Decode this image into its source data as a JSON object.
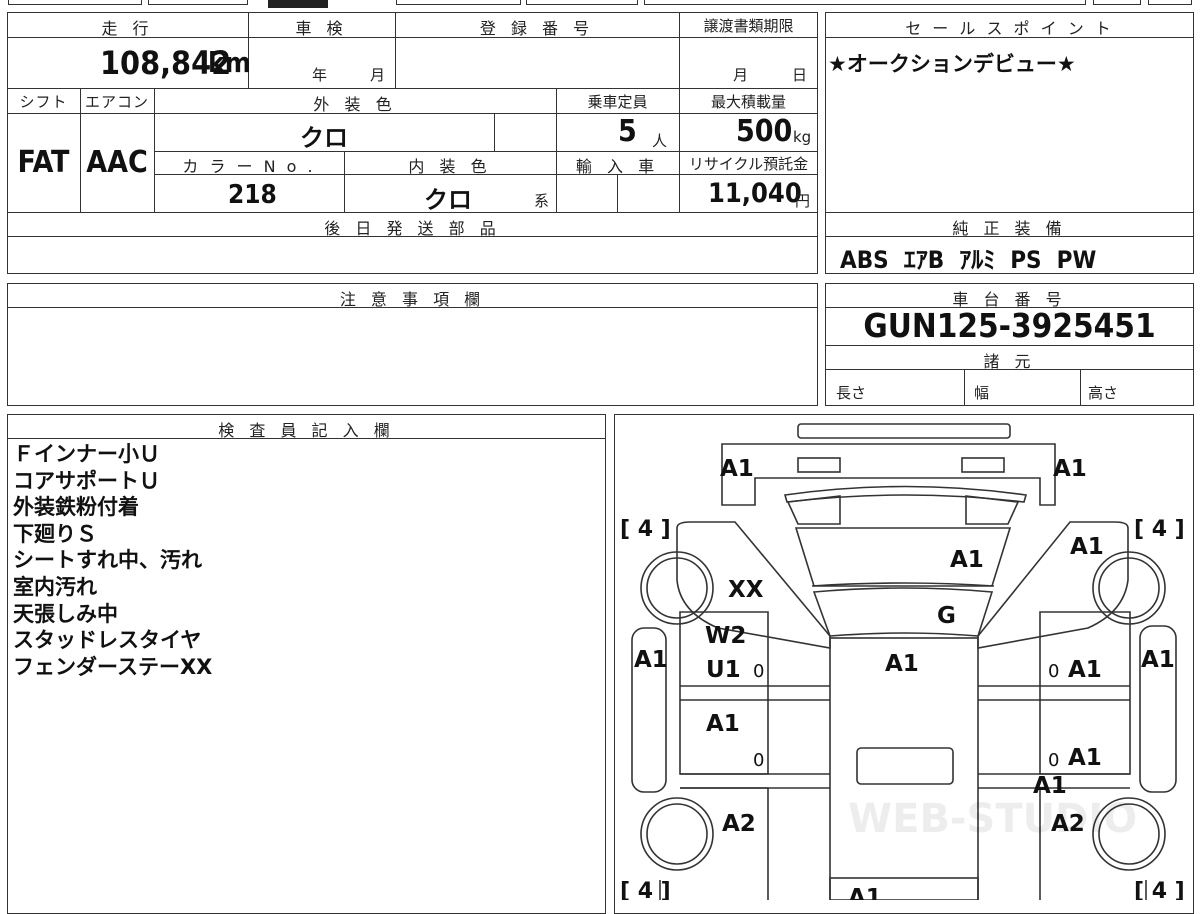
{
  "mileage": {
    "label": "走 行",
    "value": "108,842",
    "unit": "km"
  },
  "shaken": {
    "label": "車 検",
    "year_unit": "年",
    "month_unit": "月"
  },
  "registration": {
    "label": "登 録 番 号"
  },
  "transfer_deadline": {
    "label": "譲渡書類期限",
    "month_unit": "月",
    "day_unit": "日"
  },
  "shift": {
    "label": "シフト",
    "value": "FAT"
  },
  "aircon": {
    "label": "エアコン",
    "value": "AAC"
  },
  "exterior_color": {
    "label": "外 装 色",
    "value": "クロ"
  },
  "capacity": {
    "label": "乗車定員",
    "value": "5",
    "unit": "人"
  },
  "max_load": {
    "label": "最大積載量",
    "value": "500",
    "unit": "kg"
  },
  "color_no": {
    "label": "カ ラ ー N o .",
    "value": "218"
  },
  "interior_color": {
    "label": "内 装 色",
    "value": "クロ",
    "suffix": "系"
  },
  "import": {
    "label": "輸 入 車"
  },
  "recycle": {
    "label": "リサイクル預託金",
    "value": "11,040",
    "unit": "円"
  },
  "parts_later": {
    "label": "後 日 発 送 部 品"
  },
  "sales_point": {
    "label": "セ ー ル ス ポ イ ン ト",
    "text": "★オークションデビュー★"
  },
  "equipment": {
    "label": "純 正 装 備",
    "items": "ABS  ｴｱB  ｱﾙﾐ  PS  PW"
  },
  "notes": {
    "label": "注 意 事 項 欄"
  },
  "chassis": {
    "label": "車 台 番 号",
    "value": "GUN125-3925451"
  },
  "specs": {
    "label": "諸 元",
    "length": "長さ",
    "width": "幅",
    "height": "高さ"
  },
  "inspector": {
    "label": "検 査 員 記 入 欄",
    "lines": [
      "Ｆインナー小Ｕ",
      "コアサポートＵ",
      "外装鉄粉付着",
      "下廻りＳ",
      "シートすれ中、汚れ",
      "室内汚れ",
      "天張しみ中",
      "スタッドレスタイヤ",
      "フェンダーステーXX"
    ]
  },
  "diagram": {
    "tire_left_front": "[ 4 ]",
    "tire_right_front": "[ 4 ]",
    "tire_left_rear": "[ 4 ]",
    "tire_right_rear": "[ 4 ]",
    "front_left_corner": "A1",
    "front_right_corner": "A1",
    "hood": "A1",
    "front_right_fender": "A1",
    "left_apron": "XX",
    "windshield": "G",
    "left_front_door_1": "W2",
    "left_front_door_2": "U1",
    "left_front_door_digit": "0",
    "roof": "A1",
    "right_front_door_digit": "0",
    "right_front_door": "A1",
    "left_rocker": "A1",
    "right_rocker": "A1",
    "left_rear_door": "A1",
    "left_rear_door_digit": "0",
    "right_rear_door_digit": "0",
    "right_rear_door": "A1",
    "rear_roof": "A1",
    "left_rear_fender": "A2",
    "right_rear_fender": "A2",
    "tailgate": "A1",
    "watermark": "WEB-STUDIO"
  }
}
